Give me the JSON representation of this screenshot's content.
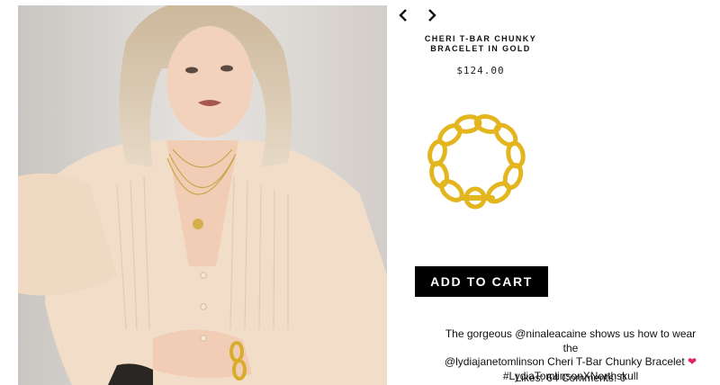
{
  "product": {
    "title": "CHERI T-BAR CHUNKY BRACELET IN GOLD",
    "price": "$124.00"
  },
  "navigation": {
    "prev_icon": "chevron-left-icon",
    "next_icon": "chevron-right-icon"
  },
  "cart": {
    "add_label": "ADD TO CART"
  },
  "post": {
    "caption_line1": "The gorgeous @ninaleacaine shows us how to wear the",
    "caption_line2": "@lydiajanetomlinson Cheri T-Bar Chunky Bracelet",
    "heart_icon": "heart-icon",
    "heart_glyph": "❤",
    "caption_line3": "#LydiaTomlinsonXNorthskull",
    "likes_label": "Likes:",
    "likes_count": "64",
    "comments_label": "Comments:",
    "comments_count": "0"
  },
  "colors": {
    "button_bg": "#000000",
    "button_text": "#ffffff",
    "heart": "#e0245e",
    "gold": "#e3b51f"
  }
}
